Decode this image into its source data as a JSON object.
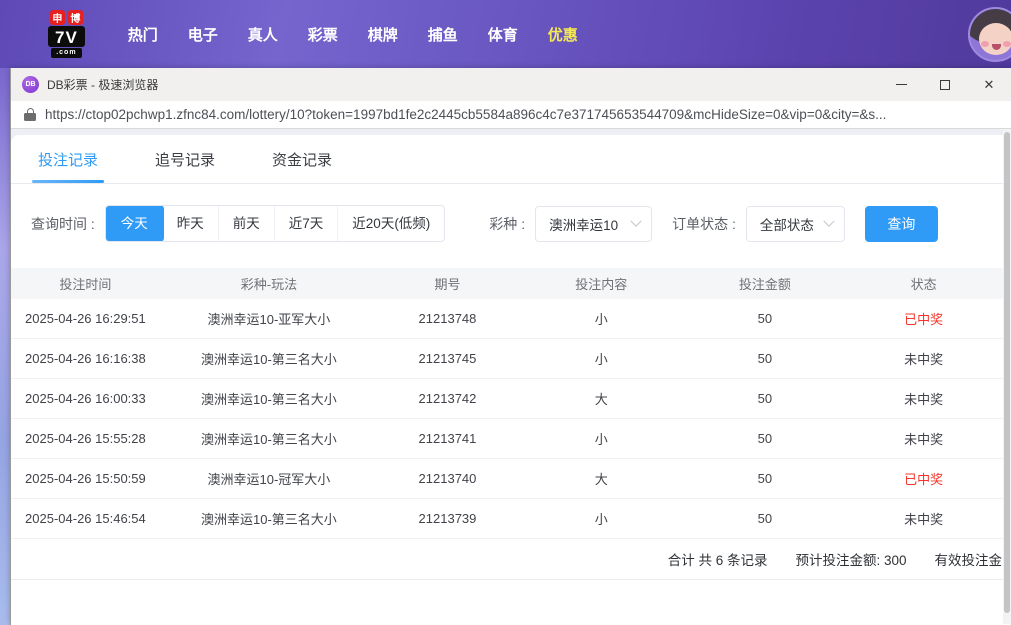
{
  "colors": {
    "accent": "#2f9bf6",
    "win_red": "#f5352b",
    "promo_yellow": "#f5e954"
  },
  "site_header": {
    "logo": {
      "badge1": "申",
      "badge2": "博",
      "line1": "7V",
      "line2": ".com"
    },
    "nav": [
      {
        "label": "热门"
      },
      {
        "label": "电子"
      },
      {
        "label": "真人"
      },
      {
        "label": "彩票"
      },
      {
        "label": "棋牌"
      },
      {
        "label": "捕鱼"
      },
      {
        "label": "体育"
      },
      {
        "label": "优惠"
      }
    ]
  },
  "browser": {
    "favicon_text": "DB",
    "title": "DB彩票 - 极速浏览器",
    "url": "https://ctop02pchwp1.zfnc84.com/lottery/10?token=1997bd1fe2c2445cb5584a896c4c7e371745653544709&mcHideSize=0&vip=0&city=&s..."
  },
  "tabs": [
    {
      "label": "投注记录"
    },
    {
      "label": "追号记录"
    },
    {
      "label": "资金记录"
    }
  ],
  "filters": {
    "time_label": "查询时间 :",
    "time_options": [
      {
        "label": "今天"
      },
      {
        "label": "昨天"
      },
      {
        "label": "前天"
      },
      {
        "label": "近7天"
      },
      {
        "label": "近20天(低频)"
      }
    ],
    "lottery_label": "彩种 :",
    "lottery_value": "澳洲幸运10",
    "status_label": "订单状态 :",
    "status_value": "全部状态",
    "search_button": "查询"
  },
  "table": {
    "columns": [
      "投注时间",
      "彩种-玩法",
      "期号",
      "投注内容",
      "投注金额",
      "状态"
    ],
    "rows": [
      {
        "time": "2025-04-26 16:29:51",
        "game": "澳洲幸运10-亚军大小",
        "issue": "21213748",
        "content": "小",
        "amount": "50",
        "status": "已中奖",
        "won": true
      },
      {
        "time": "2025-04-26 16:16:38",
        "game": "澳洲幸运10-第三名大小",
        "issue": "21213745",
        "content": "小",
        "amount": "50",
        "status": "未中奖",
        "won": false
      },
      {
        "time": "2025-04-26 16:00:33",
        "game": "澳洲幸运10-第三名大小",
        "issue": "21213742",
        "content": "大",
        "amount": "50",
        "status": "未中奖",
        "won": false
      },
      {
        "time": "2025-04-26 15:55:28",
        "game": "澳洲幸运10-第三名大小",
        "issue": "21213741",
        "content": "小",
        "amount": "50",
        "status": "未中奖",
        "won": false
      },
      {
        "time": "2025-04-26 15:50:59",
        "game": "澳洲幸运10-冠军大小",
        "issue": "21213740",
        "content": "大",
        "amount": "50",
        "status": "已中奖",
        "won": true
      },
      {
        "time": "2025-04-26 15:46:54",
        "game": "澳洲幸运10-第三名大小",
        "issue": "21213739",
        "content": "小",
        "amount": "50",
        "status": "未中奖",
        "won": false
      }
    ]
  },
  "summary": {
    "total_records": "合计 共 6 条记录",
    "expected_amount": "预计投注金额: 300",
    "valid_amount_clipped": "有效投注金"
  }
}
